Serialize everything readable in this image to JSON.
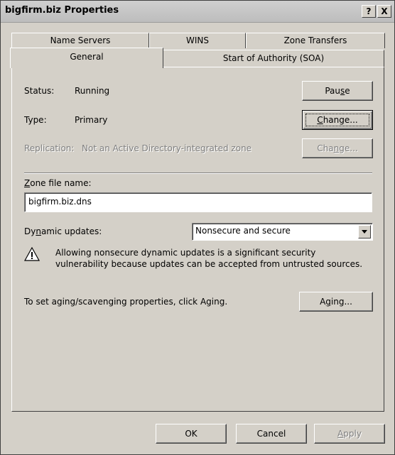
{
  "window": {
    "title": "bigfirm.biz Properties",
    "help_glyph": "?",
    "close_glyph": "X"
  },
  "tabs": {
    "back_row": [
      "Name Servers",
      "WINS",
      "Zone Transfers"
    ],
    "front_row": [
      "General",
      "Start of Authority (SOA)"
    ],
    "selected": "General"
  },
  "general": {
    "status_label": "Status:",
    "status_value": "Running",
    "pause_button": {
      "pre": "Pau",
      "key": "s",
      "post": "e"
    },
    "type_label": "Type:",
    "type_value": "Primary",
    "change_button": {
      "pre": "",
      "key": "C",
      "post": "hange..."
    },
    "replication_label": "Replication:",
    "replication_value": "Not an Active Directory-integrated zone",
    "change2_button": {
      "pre": "Cha",
      "key": "n",
      "post": "ge..."
    },
    "zone_file_label": {
      "pre": "",
      "key": "Z",
      "post": "one file name:"
    },
    "zone_file_value": "bigfirm.biz.dns",
    "dynamic_label": {
      "pre": "Dy",
      "key": "n",
      "post": "amic updates:"
    },
    "dynamic_value": "Nonsecure and secure",
    "warning_text": "Allowing nonsecure dynamic updates is a significant security vulnerability because updates can be accepted from untrusted sources.",
    "aging_text": "To set aging/scavenging properties, click Aging.",
    "aging_button": {
      "pre": "A",
      "key": "g",
      "post": "ing..."
    }
  },
  "footer": {
    "ok": "OK",
    "cancel": "Cancel",
    "apply": {
      "pre": "",
      "key": "A",
      "post": "pply"
    }
  },
  "icons": {
    "warning": "warning-triangle-icon",
    "dropdown": "chevron-down-icon"
  }
}
